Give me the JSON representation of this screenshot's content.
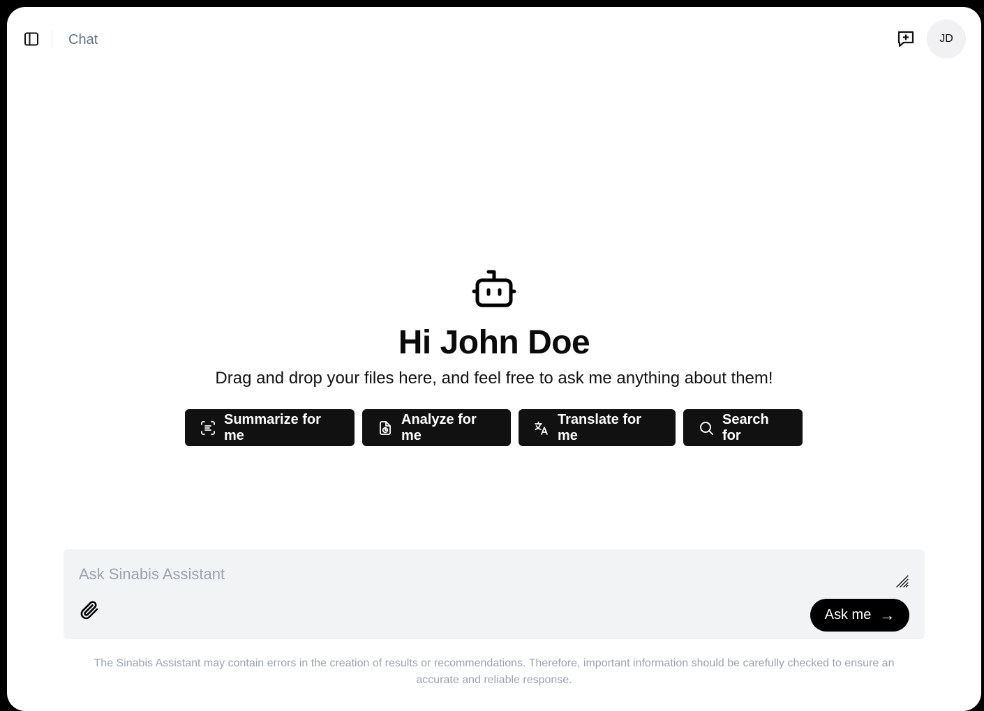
{
  "header": {
    "title": "Chat",
    "avatar_initials": "JD"
  },
  "icons": {
    "sidebar_toggle": "sidebar-panel-icon",
    "new_chat": "message-plus-icon",
    "bot": "robot-icon",
    "attach": "paperclip-icon",
    "resize": "resize-grip-icon"
  },
  "hero": {
    "title": "Hi John Doe",
    "subtitle": "Drag and drop your files here, and feel free to ask me anything about them!"
  },
  "suggestions": [
    {
      "label": "Summarize for me",
      "icon": "scan-text-icon"
    },
    {
      "label": "Analyze for me",
      "icon": "file-chart-icon"
    },
    {
      "label": "Translate for me",
      "icon": "languages-icon"
    },
    {
      "label": "Search for",
      "icon": "search-icon"
    }
  ],
  "composer": {
    "placeholder": "Ask Sinabis Assistant",
    "submit_label": "Ask me",
    "submit_arrow": "→"
  },
  "disclaimer": "The Sinabis Assistant may contain errors in the creation of results or recommendations. Therefore, important information should be carefully checked to ensure an accurate and reliable response.",
  "colors": {
    "background": "#ffffff",
    "button": "#111111",
    "composer_bg": "#f2f3f5",
    "muted_text": "#9ca3af"
  }
}
